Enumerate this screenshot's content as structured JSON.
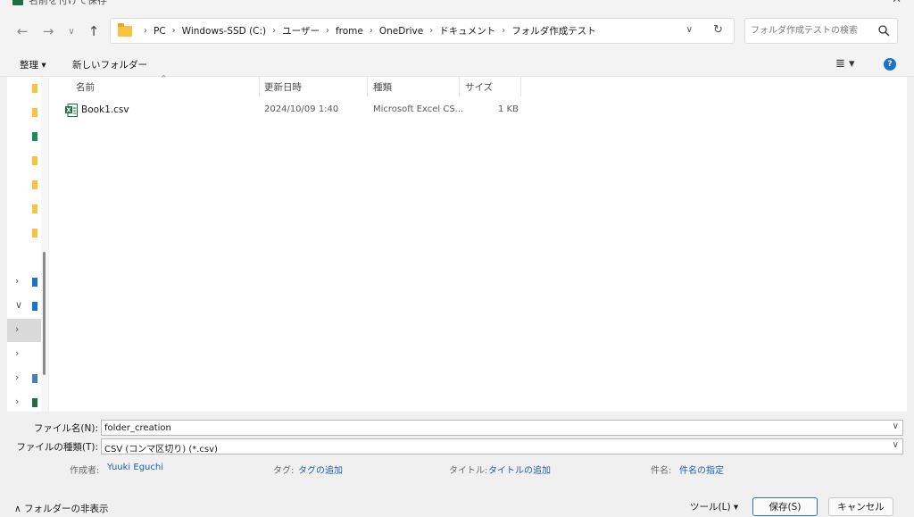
{
  "window": {
    "title": "名前を付けて保存",
    "close_glyph": "✕"
  },
  "nav": {
    "back_glyph": "←",
    "forward_glyph": "→",
    "recent_glyph": "∨",
    "up_glyph": "↑",
    "breadcrumb": [
      "PC",
      "Windows-SSD (C:)",
      "ユーザー",
      "frome",
      "OneDrive",
      "ドキュメント",
      "フォルダ作成テスト"
    ],
    "dropdown_glyph": "∨",
    "refresh_glyph": "↻",
    "search_placeholder": "フォルダ作成テストの検索"
  },
  "toolbar": {
    "organize_label": "整理 ▾",
    "new_folder_label": "新しいフォルダー",
    "view_glyph": "≣ ▾",
    "help_glyph": "?"
  },
  "navpane": {
    "rows": [
      {
        "chevron": "",
        "color": "#f6c343"
      },
      {
        "chevron": "",
        "color": "#f6c343"
      },
      {
        "chevron": "",
        "color": "#1d8a5a"
      },
      {
        "chevron": "",
        "color": "#f6c343"
      },
      {
        "chevron": "",
        "color": "#f6c343"
      },
      {
        "chevron": "",
        "color": "#f6c343"
      },
      {
        "chevron": "",
        "color": "#f6c343"
      },
      {
        "chevron": "›",
        "color": "#1a73c9"
      },
      {
        "chevron": "∨",
        "color": "#1a73c9"
      },
      {
        "chevron": "›",
        "color": ""
      },
      {
        "chevron": "›",
        "color": ""
      },
      {
        "chevron": "›",
        "color": "#4a7fb5"
      },
      {
        "chevron": "›",
        "color": "#1d6f42"
      }
    ]
  },
  "filelist": {
    "columns": {
      "name": "名前",
      "modified": "更新日時",
      "type": "種類",
      "size": "サイズ"
    },
    "sort_glyph": "^",
    "files": [
      {
        "name": "Book1.csv",
        "modified": "2024/10/09 1:40",
        "type": "Microsoft Excel CS...",
        "size": "1 KB"
      }
    ]
  },
  "save": {
    "filename_label": "ファイル名(N):",
    "filename_value": "folder_creation",
    "filetype_label": "ファイルの種類(T):",
    "filetype_value": "CSV (コンマ区切り) (*.csv)",
    "combo_arrow": "∨",
    "author_label": "作成者:",
    "author_value": "Yuuki Eguchi",
    "tags_label": "タグ:",
    "tags_value": "タグの追加",
    "title_label": "タイトル:",
    "title_value": "タイトルの追加",
    "subject_label": "件名:",
    "subject_value": "件名の指定"
  },
  "bottom": {
    "hide_folders_label": "∧ フォルダーの非表示",
    "tools_label": "ツール(L)   ▾",
    "save_label": "保存(S)",
    "cancel_label": "キャンセル"
  },
  "colors": {
    "accent": "#1a73c9",
    "excel_green": "#1d6f42",
    "link_blue": "#1f5fae"
  }
}
